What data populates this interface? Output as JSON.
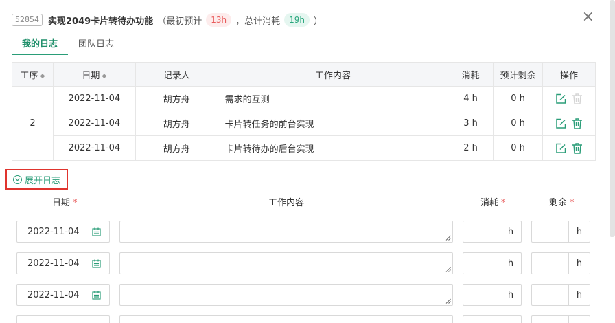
{
  "task": {
    "id": "52854",
    "title": "实现2049卡片转待办功能",
    "initial_estimate_prefix": "（最初预计",
    "initial_estimate": "13h",
    "total_consumed_prefix": "，总计消耗",
    "total_consumed": "19h",
    "suffix": "）"
  },
  "close_glyph": "×",
  "tabs": [
    {
      "label": "我的日志",
      "active": true
    },
    {
      "label": "团队日志",
      "active": false
    }
  ],
  "table": {
    "headers": [
      "工序",
      "日期",
      "记录人",
      "工作内容",
      "消耗",
      "预计剩余",
      "操作"
    ],
    "sort_glyph": "◆",
    "step": "2",
    "rows": [
      {
        "date": "2022-11-04",
        "recorder": "胡方舟",
        "content": "需求的互测",
        "consumed": "4 h",
        "remaining": "0 h",
        "delete_enabled": false
      },
      {
        "date": "2022-11-04",
        "recorder": "胡方舟",
        "content": "卡片转任务的前台实现",
        "consumed": "3 h",
        "remaining": "0 h",
        "delete_enabled": true
      },
      {
        "date": "2022-11-04",
        "recorder": "胡方舟",
        "content": "卡片转待办的后台实现",
        "consumed": "2 h",
        "remaining": "0 h",
        "delete_enabled": true
      }
    ]
  },
  "expand_label": "展开日志",
  "form": {
    "headers": {
      "date": "日期",
      "content": "工作内容",
      "consumed": "消耗",
      "remaining": "剩余"
    },
    "required_mark": "*",
    "unit": "h",
    "rows": [
      {
        "date": "2022-11-04",
        "content": "",
        "consumed": "",
        "remaining": ""
      },
      {
        "date": "2022-11-04",
        "content": "",
        "consumed": "",
        "remaining": ""
      },
      {
        "date": "2022-11-04",
        "content": "",
        "consumed": "",
        "remaining": ""
      }
    ]
  },
  "colors": {
    "accent": "#2a9d78",
    "danger": "#e85b5b",
    "highlight_border": "#e0342e"
  }
}
